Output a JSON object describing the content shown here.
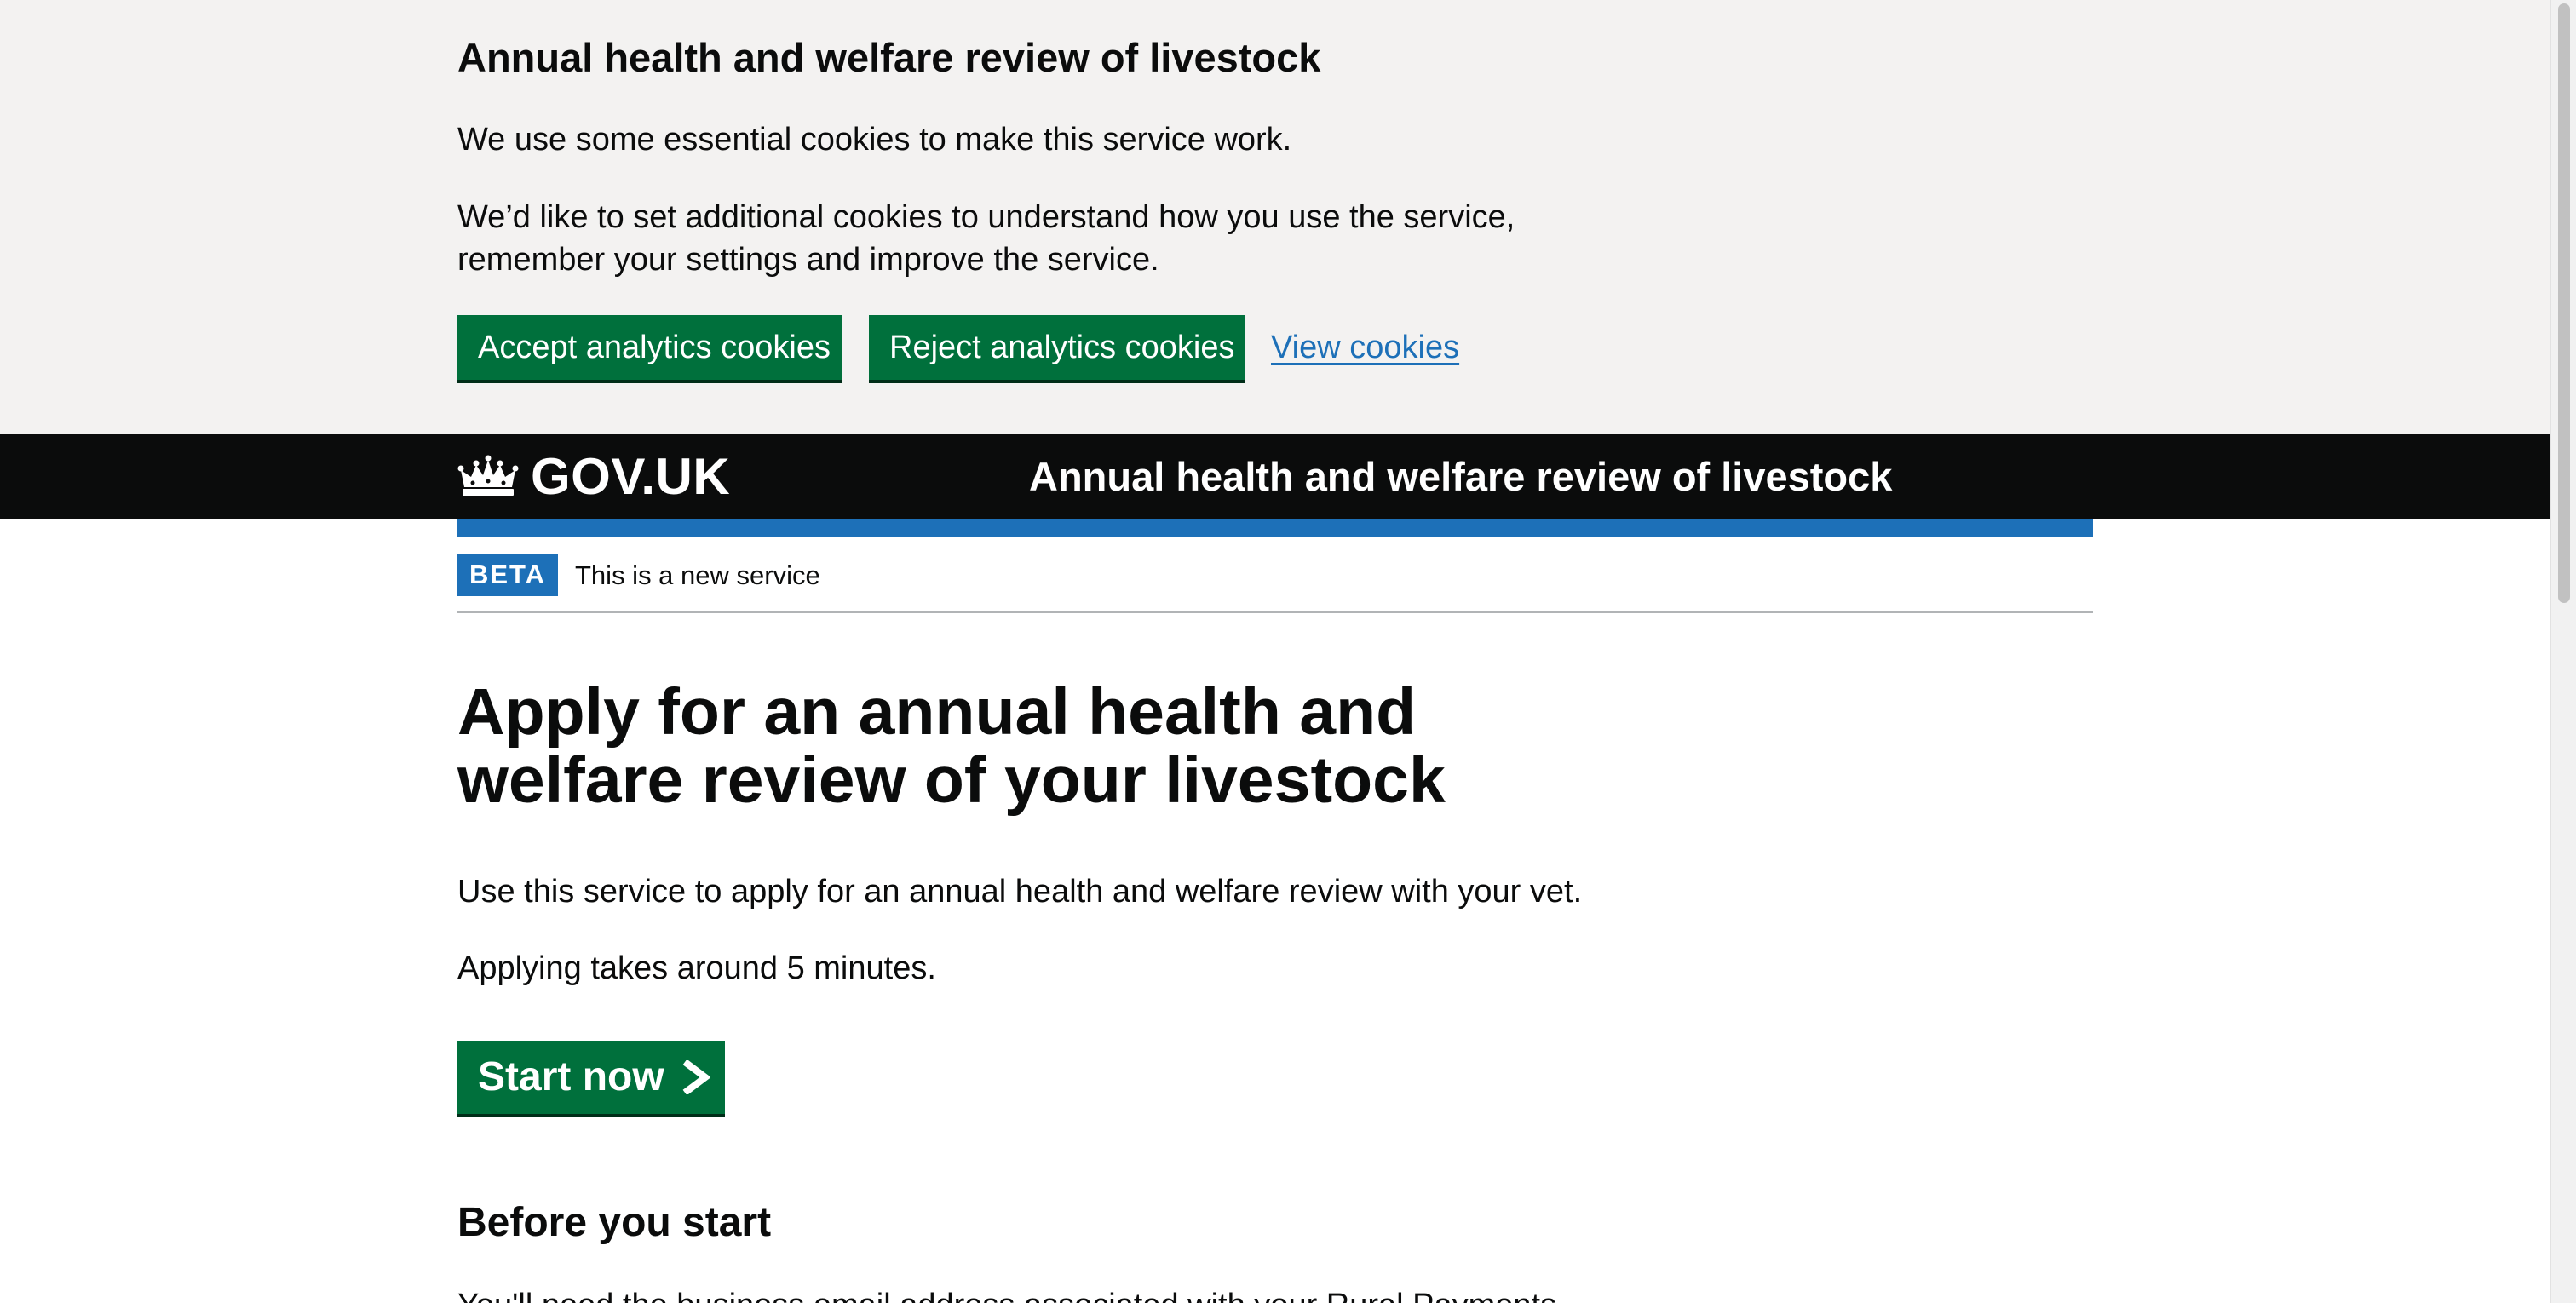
{
  "cookie_banner": {
    "heading": "Annual health and welfare review of livestock",
    "paragraph_1": "We use some essential cookies to make this service work.",
    "paragraph_2": "We’d like to set additional cookies to understand how you use the service, remember your settings and improve the service.",
    "accept_label": "Accept analytics cookies",
    "reject_label": "Reject analytics cookies",
    "view_link": "View cookies"
  },
  "header": {
    "logo_text": "GOV.UK",
    "service_name": "Annual health and welfare review of livestock",
    "logo_icon": "crown-icon"
  },
  "phase_banner": {
    "tag": "BETA",
    "text": "This is a new service"
  },
  "main": {
    "heading": "Apply for an annual health and welfare review of your livestock",
    "intro_1": "Use this service to apply for an annual health and welfare review with your vet.",
    "intro_2": "Applying takes around 5 minutes.",
    "start_label": "Start now",
    "start_icon": "chevron-right-icon",
    "before_heading": "Before you start",
    "before_text": "You'll need the business email address associated with your Rural Payments"
  },
  "colors": {
    "button_green": "#00703c",
    "link_blue": "#1d70b8",
    "header_black": "#0b0c0c",
    "banner_grey": "#f3f2f1"
  }
}
